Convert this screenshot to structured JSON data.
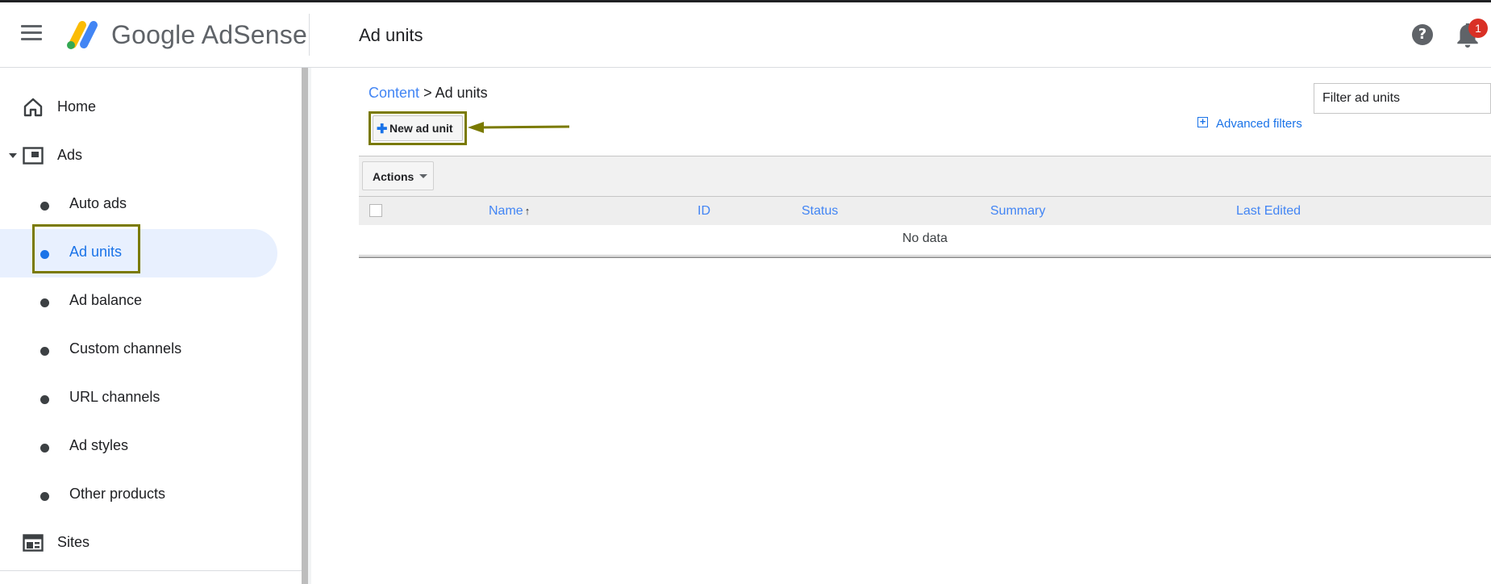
{
  "header": {
    "brand": "Google AdSense",
    "title": "Ad units",
    "notification_count": "1"
  },
  "sidebar": {
    "items": [
      {
        "label": "Home",
        "icon": "home-icon"
      },
      {
        "label": "Ads",
        "icon": "ads-icon"
      },
      {
        "label": "Auto ads"
      },
      {
        "label": "Ad units"
      },
      {
        "label": "Ad balance"
      },
      {
        "label": "Custom channels"
      },
      {
        "label": "URL channels"
      },
      {
        "label": "Ad styles"
      },
      {
        "label": "Other products"
      },
      {
        "label": "Sites",
        "icon": "sites-icon"
      }
    ],
    "active_item": "Ad units"
  },
  "breadcrumb": {
    "parent": "Content",
    "separator": ">",
    "current": "Ad units"
  },
  "toolbar": {
    "new_ad_unit_label": "New ad unit",
    "advanced_filters_label": "Advanced filters",
    "filter_placeholder": "Filter ad units"
  },
  "actions": {
    "label": "Actions"
  },
  "table": {
    "columns": [
      "Name",
      "ID",
      "Status",
      "Summary",
      "Last Edited"
    ],
    "sorted_column": "Name",
    "empty_text": "No data"
  },
  "colors": {
    "accent": "#1a73e8",
    "link": "#4285f4",
    "highlight_annotation": "#7a7a00",
    "badge": "#d93025"
  }
}
